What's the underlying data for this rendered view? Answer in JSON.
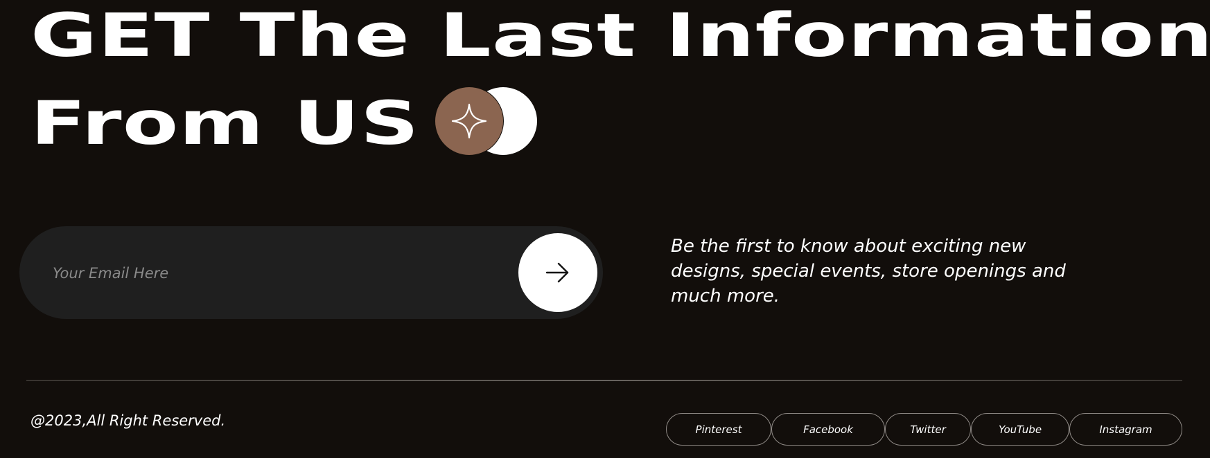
{
  "headline": {
    "line1": "GET The Last Information",
    "line2": "From US"
  },
  "badge": {
    "icon": "sparkle-icon",
    "colors": {
      "front": "#8b6550",
      "back": "#ffffff"
    }
  },
  "subscribe": {
    "placeholder": "Your Email Here",
    "value": "",
    "submit_icon": "arrow-right-icon"
  },
  "tagline": "Be the first to know about exciting new designs, special events, store openings and much more.",
  "footer": {
    "copyright": "@2023,All Right Reserved.",
    "social_links": [
      {
        "label": "Pinterest"
      },
      {
        "label": "Facebook"
      },
      {
        "label": "Twitter"
      },
      {
        "label": "YouTube"
      },
      {
        "label": "Instagram"
      }
    ]
  },
  "colors": {
    "background": "#120e0b",
    "input_background": "#1f1f1f",
    "accent": "#8b6550",
    "text": "#ffffff"
  }
}
